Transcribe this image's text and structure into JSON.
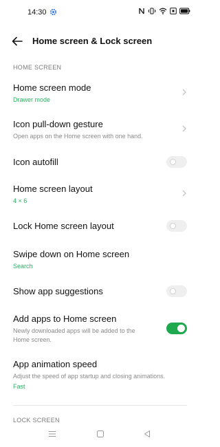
{
  "status_bar": {
    "time": "14:30"
  },
  "header": {
    "title": "Home screen & Lock screen"
  },
  "sections": {
    "home_screen": "HOME SCREEN",
    "lock_screen": "LOCK SCREEN"
  },
  "rows": {
    "home_screen_mode": {
      "title": "Home screen mode",
      "value": "Drawer mode"
    },
    "icon_pull_down": {
      "title": "Icon pull-down gesture",
      "desc": "Open apps on the Home screen with one hand."
    },
    "icon_autofill": {
      "title": "Icon autofill",
      "on": false
    },
    "home_screen_layout": {
      "title": "Home screen layout",
      "value": "4 × 6"
    },
    "lock_layout": {
      "title": "Lock Home screen layout",
      "on": false
    },
    "swipe_down": {
      "title": "Swipe down on Home screen",
      "value": "Search"
    },
    "show_suggestions": {
      "title": "Show app suggestions",
      "on": false
    },
    "add_apps": {
      "title": "Add apps to Home screen",
      "desc": "Newly downloaded apps will be added to the Home screen.",
      "on": true
    },
    "animation_speed": {
      "title": "App animation speed",
      "desc": "Adjust the speed of app startup and closing animations.",
      "value": "Fast"
    }
  },
  "colors": {
    "accent": "#2bb163",
    "toggle_on": "#1fa94f"
  },
  "icons": {
    "status": [
      "settings-gear-icon",
      "nfc-icon",
      "vibrate-icon",
      "wifi-icon",
      "screen-record-icon",
      "battery-icon"
    ],
    "nav": [
      "menu-icon",
      "home-icon",
      "back-triangle-icon"
    ]
  }
}
